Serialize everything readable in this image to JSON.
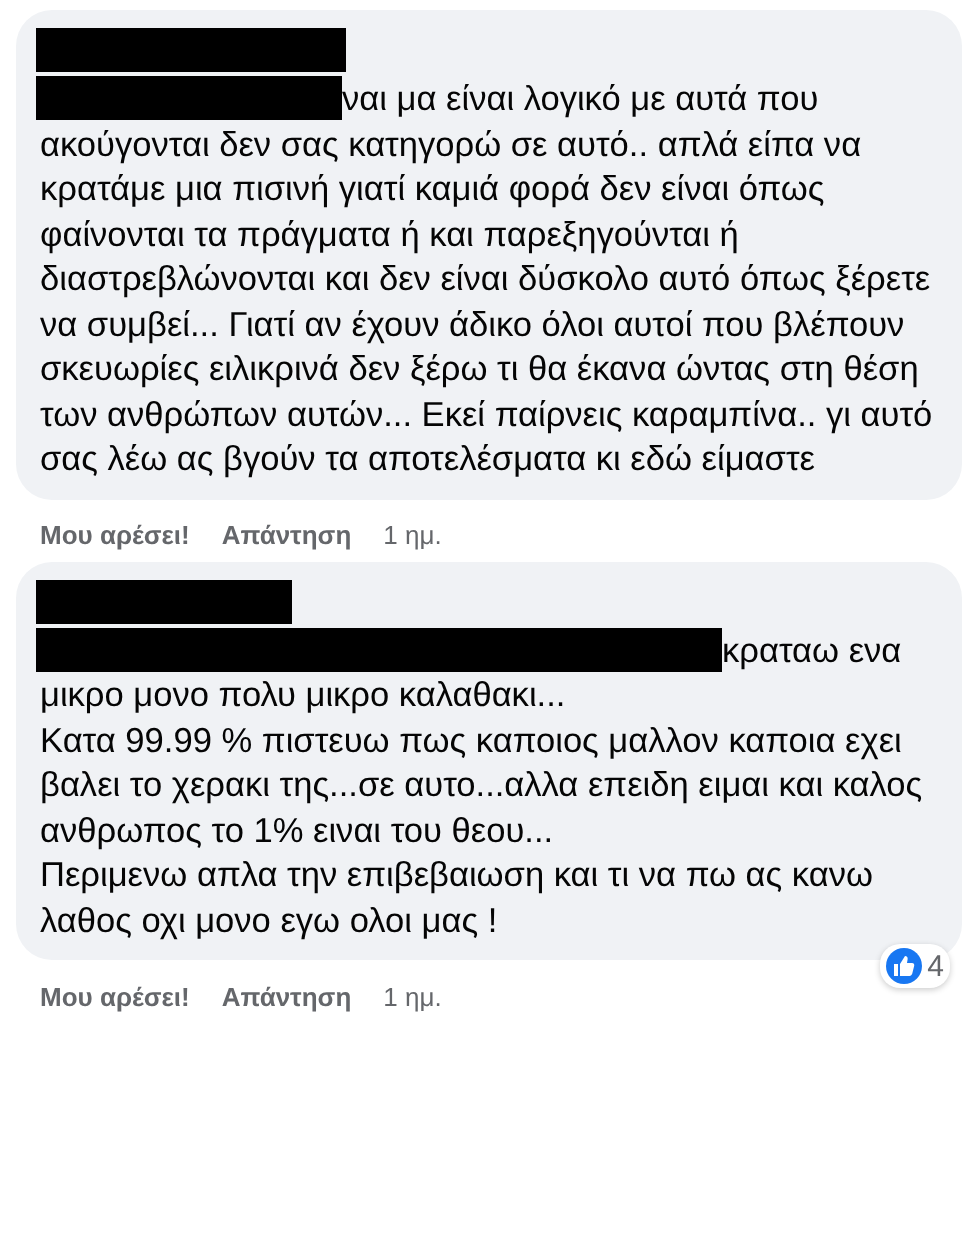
{
  "comments": [
    {
      "paragraphs": [
        "ναι μα είναι λογικό με αυτά που ακούγονται δεν σας κατηγορώ σε αυτό.. απλά είπα να κρατάμε μια πισινή γιατί καμιά φορά δεν είναι όπως φαίνονται τα πράγματα ή και παρεξηγούνται ή διαστρεβλώνονται και δεν είναι δύσκολο αυτό όπως ξέρετε να συμβεί... Γιατί αν έχουν άδικο όλοι αυτοί που βλέπουν σκευωρίες ειλικρινά δεν ξέρω τι θα έκανα ώντας στη θέση των ανθρώπων αυτών... Εκεί παίρνεις καραμπίνα.. γι αυτό σας λέω ας βγούν τα αποτελέσματα κι εδώ είμαστε"
      ],
      "like": "Μου αρέσει!",
      "reply": "Απάντηση",
      "time": "1 ημ."
    },
    {
      "paragraphs": [
        "κραταω ενα μικρο μονο πολυ μικρο καλαθακι...",
        "Κατα 99.99 % πιστευω πως καποιος μαλλον καποια εχει βαλει το χερακι της...σε αυτο...αλλα επειδη ειμαι και καλος ανθρωπος το 1% ειναι του θεου...",
        "Περιμενω απλα την επιβεβαιωση και τι να πω ας κανω λαθος οχι μονο εγω ολοι μας !"
      ],
      "reaction_count": "4",
      "like": "Μου αρέσει!",
      "reply": "Απάντηση",
      "time": "1 ημ."
    }
  ]
}
